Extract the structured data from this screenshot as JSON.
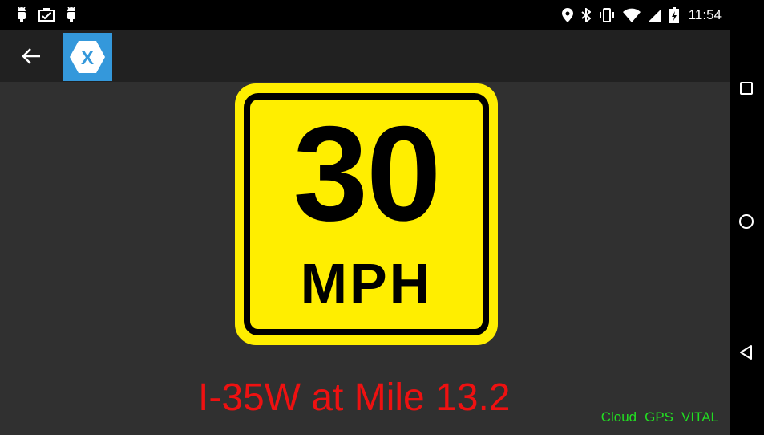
{
  "status_bar": {
    "time": "11:54",
    "left_icons": [
      "android-debug-icon",
      "screenshot-icon",
      "android-debug-icon"
    ],
    "right_icons": [
      "location-icon",
      "bluetooth-icon",
      "vibrate-icon",
      "wifi-icon",
      "signal-icon",
      "battery-charging-icon"
    ]
  },
  "app_bar": {
    "back_icon": "arrow-left-icon",
    "logo_letter": "X",
    "logo_color": "#3498db"
  },
  "sign": {
    "speed": "30",
    "unit": "MPH",
    "background_color": "#ffee00"
  },
  "location": {
    "text": "I-35W at Mile 13.2",
    "color": "#ee1111"
  },
  "indicators": {
    "items": [
      "Cloud",
      "GPS",
      "VITAL"
    ],
    "color": "#22dd22"
  },
  "nav_bar": {
    "icons": [
      "recent-apps-icon",
      "home-icon",
      "back-icon"
    ]
  }
}
